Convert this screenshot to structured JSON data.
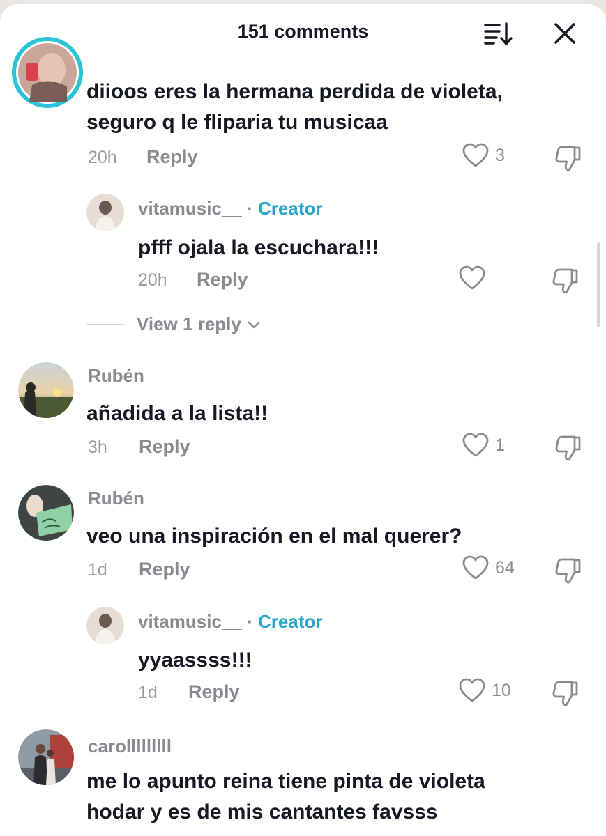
{
  "header": {
    "title": "151 comments"
  },
  "comments": [
    {
      "text": "diioos eres la hermana perdida de violeta, seguro q le fliparia tu musicaa",
      "text_line1": "diioos eres la hermana perdida de violeta,",
      "text_line2": "seguro q le fliparia tu musicaa",
      "time": "20h",
      "reply": "Reply",
      "likes": "3"
    },
    {
      "username": "vitamusic__",
      "badge": "Creator",
      "text": "pfff ojala la escuchara!!!",
      "time": "20h",
      "reply": "Reply",
      "likes": ""
    },
    {
      "username": "Rubén",
      "text": "añadida a la lista!!",
      "time": "3h",
      "reply": "Reply",
      "likes": "1"
    },
    {
      "username": "Rubén",
      "text": "veo una inspiración en el mal querer?",
      "time": "1d",
      "reply": "Reply",
      "likes": "64"
    },
    {
      "username": "vitamusic__",
      "badge": "Creator",
      "text": "yyaassss!!!",
      "time": "1d",
      "reply": "Reply",
      "likes": "10"
    },
    {
      "username": "carolllllllll__",
      "text": "me lo apunto reina tiene pinta de violeta hodar y es de mis cantantes favsss",
      "text_line1": "me lo apunto reina tiene pinta de violeta",
      "text_line2": "hodar y es de mis cantantes favsss"
    }
  ],
  "view_replies": {
    "label": "View 1 reply",
    "icon": "chevron-down-icon"
  },
  "colors": {
    "creator": "#2ba5c8",
    "ring": "#2bc4d6",
    "muted": "#8a8b91",
    "text": "#161823"
  }
}
